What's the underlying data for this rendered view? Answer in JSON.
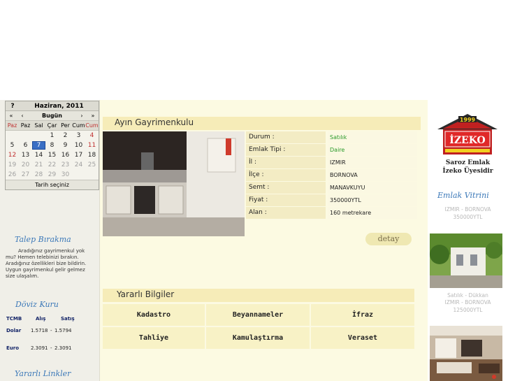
{
  "calendar": {
    "help": "?",
    "month_title": "Haziran, 2011",
    "nav": [
      "«",
      "‹",
      "Bugün",
      "›",
      "»"
    ],
    "days": [
      "Paz",
      "Paz",
      "Sal",
      "Çar",
      "Per",
      "Cum",
      "Cum"
    ],
    "weeks": [
      [
        "",
        "",
        "",
        "1",
        "2",
        "3",
        "4"
      ],
      [
        "5",
        "6",
        "7",
        "8",
        "9",
        "10",
        "11"
      ],
      [
        "12",
        "13",
        "14",
        "15",
        "16",
        "17",
        "18"
      ],
      [
        "19",
        "20",
        "21",
        "22",
        "23",
        "24",
        "25"
      ],
      [
        "26",
        "27",
        "28",
        "29",
        "30",
        "",
        ""
      ]
    ],
    "today": "7",
    "footer": "Tarih seçiniz"
  },
  "left": {
    "talep_title": "Talep Bırakma",
    "talep_text": "Aradığınız gayrimenkul yok mu? Hemen telebinizi bırakın. Aradığınız özellikleri bize bildirin. Uygun gayrimenkul gelir gelmez size ulaşalım.",
    "doviz_title": "Döviz Kuru",
    "doviz_headers": [
      "TCMB",
      "Alış",
      "Satış"
    ],
    "doviz_rows": [
      {
        "name": "Dolar",
        "alis": "1.5718",
        "satis": "1.5794"
      },
      {
        "name": "Euro",
        "alis": "2.3091",
        "satis": "2.3091"
      }
    ],
    "links_title": "Yararlı Linkler"
  },
  "featured": {
    "title": "Ayın Gayrimenkulu",
    "rows": [
      {
        "key": "Durum :",
        "value": "Satılık"
      },
      {
        "key": "Emlak Tipi :",
        "value": "Daire"
      },
      {
        "key": "İl :",
        "value": "IZMIR"
      },
      {
        "key": "İlçe :",
        "value": "BORNOVA"
      },
      {
        "key": "Semt :",
        "value": "MANAVKUYU"
      },
      {
        "key": "Fiyat :",
        "value": "350000YTL"
      },
      {
        "key": "Alan :",
        "value": "160 metrekare"
      }
    ],
    "detail_button": "detay"
  },
  "useful": {
    "title": "Yararlı Bilgiler",
    "items": [
      "Kadastro",
      "Beyannameler",
      "İfraz",
      "Tahliye",
      "Kamulaştırma",
      "Veraset"
    ]
  },
  "right": {
    "logo_year": "1999",
    "logo_text": "İZEKO",
    "company_line1": "Saroz Emlak",
    "company_line2": "İzeko Üyesidir",
    "vitrin_title": "Emlak Vitrini",
    "vitrin1_line1": "IZMIR - BORNOVA",
    "vitrin1_line2": "350000YTL",
    "vitrin2_line1": "Satılık - Dükkan",
    "vitrin2_line2": "IZMIR - BORNOVA",
    "vitrin2_line3": "125000YTL"
  },
  "colors": {
    "accent_blue": "#3b78b8",
    "header_band": "#f6ecb8",
    "status_green": "#2a9a2a",
    "today_bg": "#3a6fc4"
  }
}
